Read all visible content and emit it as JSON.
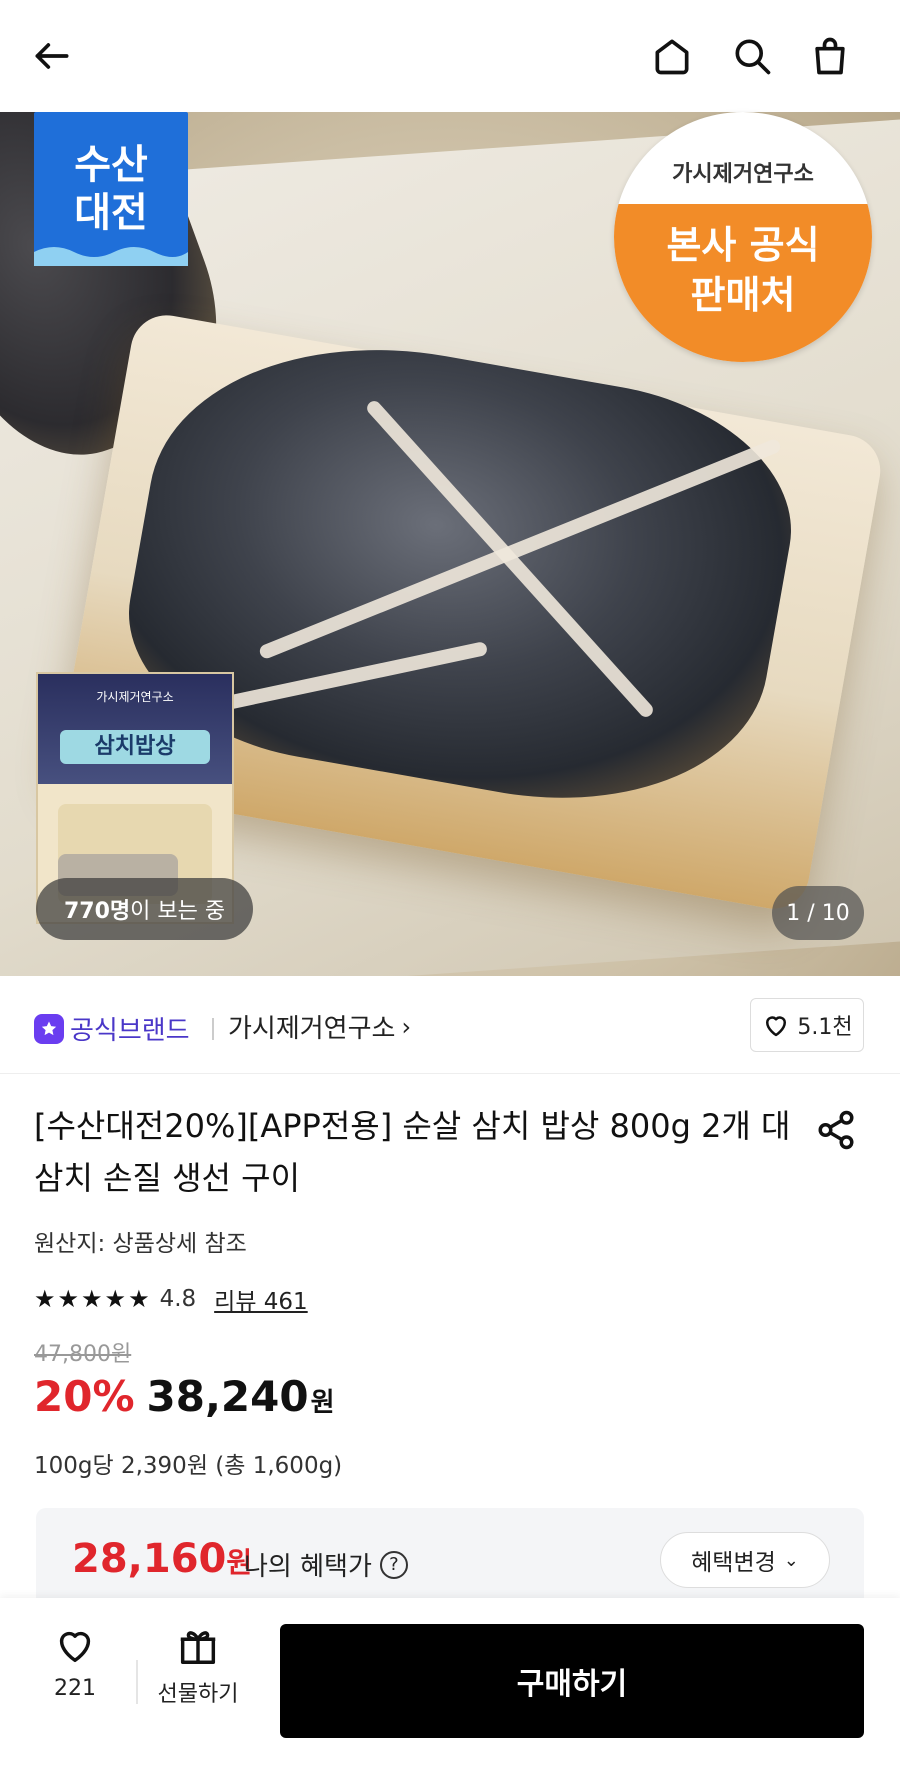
{
  "header": {
    "back_icon": "arrow-left-icon",
    "home_icon": "home-icon",
    "search_icon": "search-icon",
    "cart_icon": "shopping-bag-icon"
  },
  "hero": {
    "badge_left_line1": "수산",
    "badge_left_line2": "대전",
    "badge_right_brand": "가시제거연구소",
    "badge_right_line1": "본사 공식",
    "badge_right_line2": "판매처",
    "package_brand": "가시제거연구소",
    "package_title": "삼치밥상",
    "viewers_count": "770명",
    "viewers_suffix": "이 보는 중",
    "pager": "1 / 10"
  },
  "brand": {
    "official_label": "공식브랜드",
    "name": "가시제거연구소",
    "chevron": "›",
    "likes": "5.1천"
  },
  "product": {
    "title": "[수산대전20%][APP전용] 순살 삼치 밥상 800g 2개 대삼치 손질 생선 구이",
    "origin": "원산지: 상품상세 참조",
    "stars": "★★★★★",
    "rating": "4.8",
    "review": "리뷰 461",
    "old_price": "47,800원",
    "discount": "20%",
    "price": "38,240",
    "won": "원",
    "unit_price": "100g당 2,390원 (총 1,600g)"
  },
  "benefit": {
    "price": "28,160",
    "won": "원",
    "label": "나의 혜택가",
    "help": "?",
    "change_button": "혜택변경",
    "chevron": "⌄"
  },
  "bottom": {
    "wish_count": "221",
    "gift_label": "선물하기",
    "buy_label": "구매하기"
  },
  "colors": {
    "accent_red": "#e0262c",
    "official_purple": "#4a37c8",
    "badge_blue": "#1f6fd9",
    "badge_orange": "#f28c28"
  }
}
